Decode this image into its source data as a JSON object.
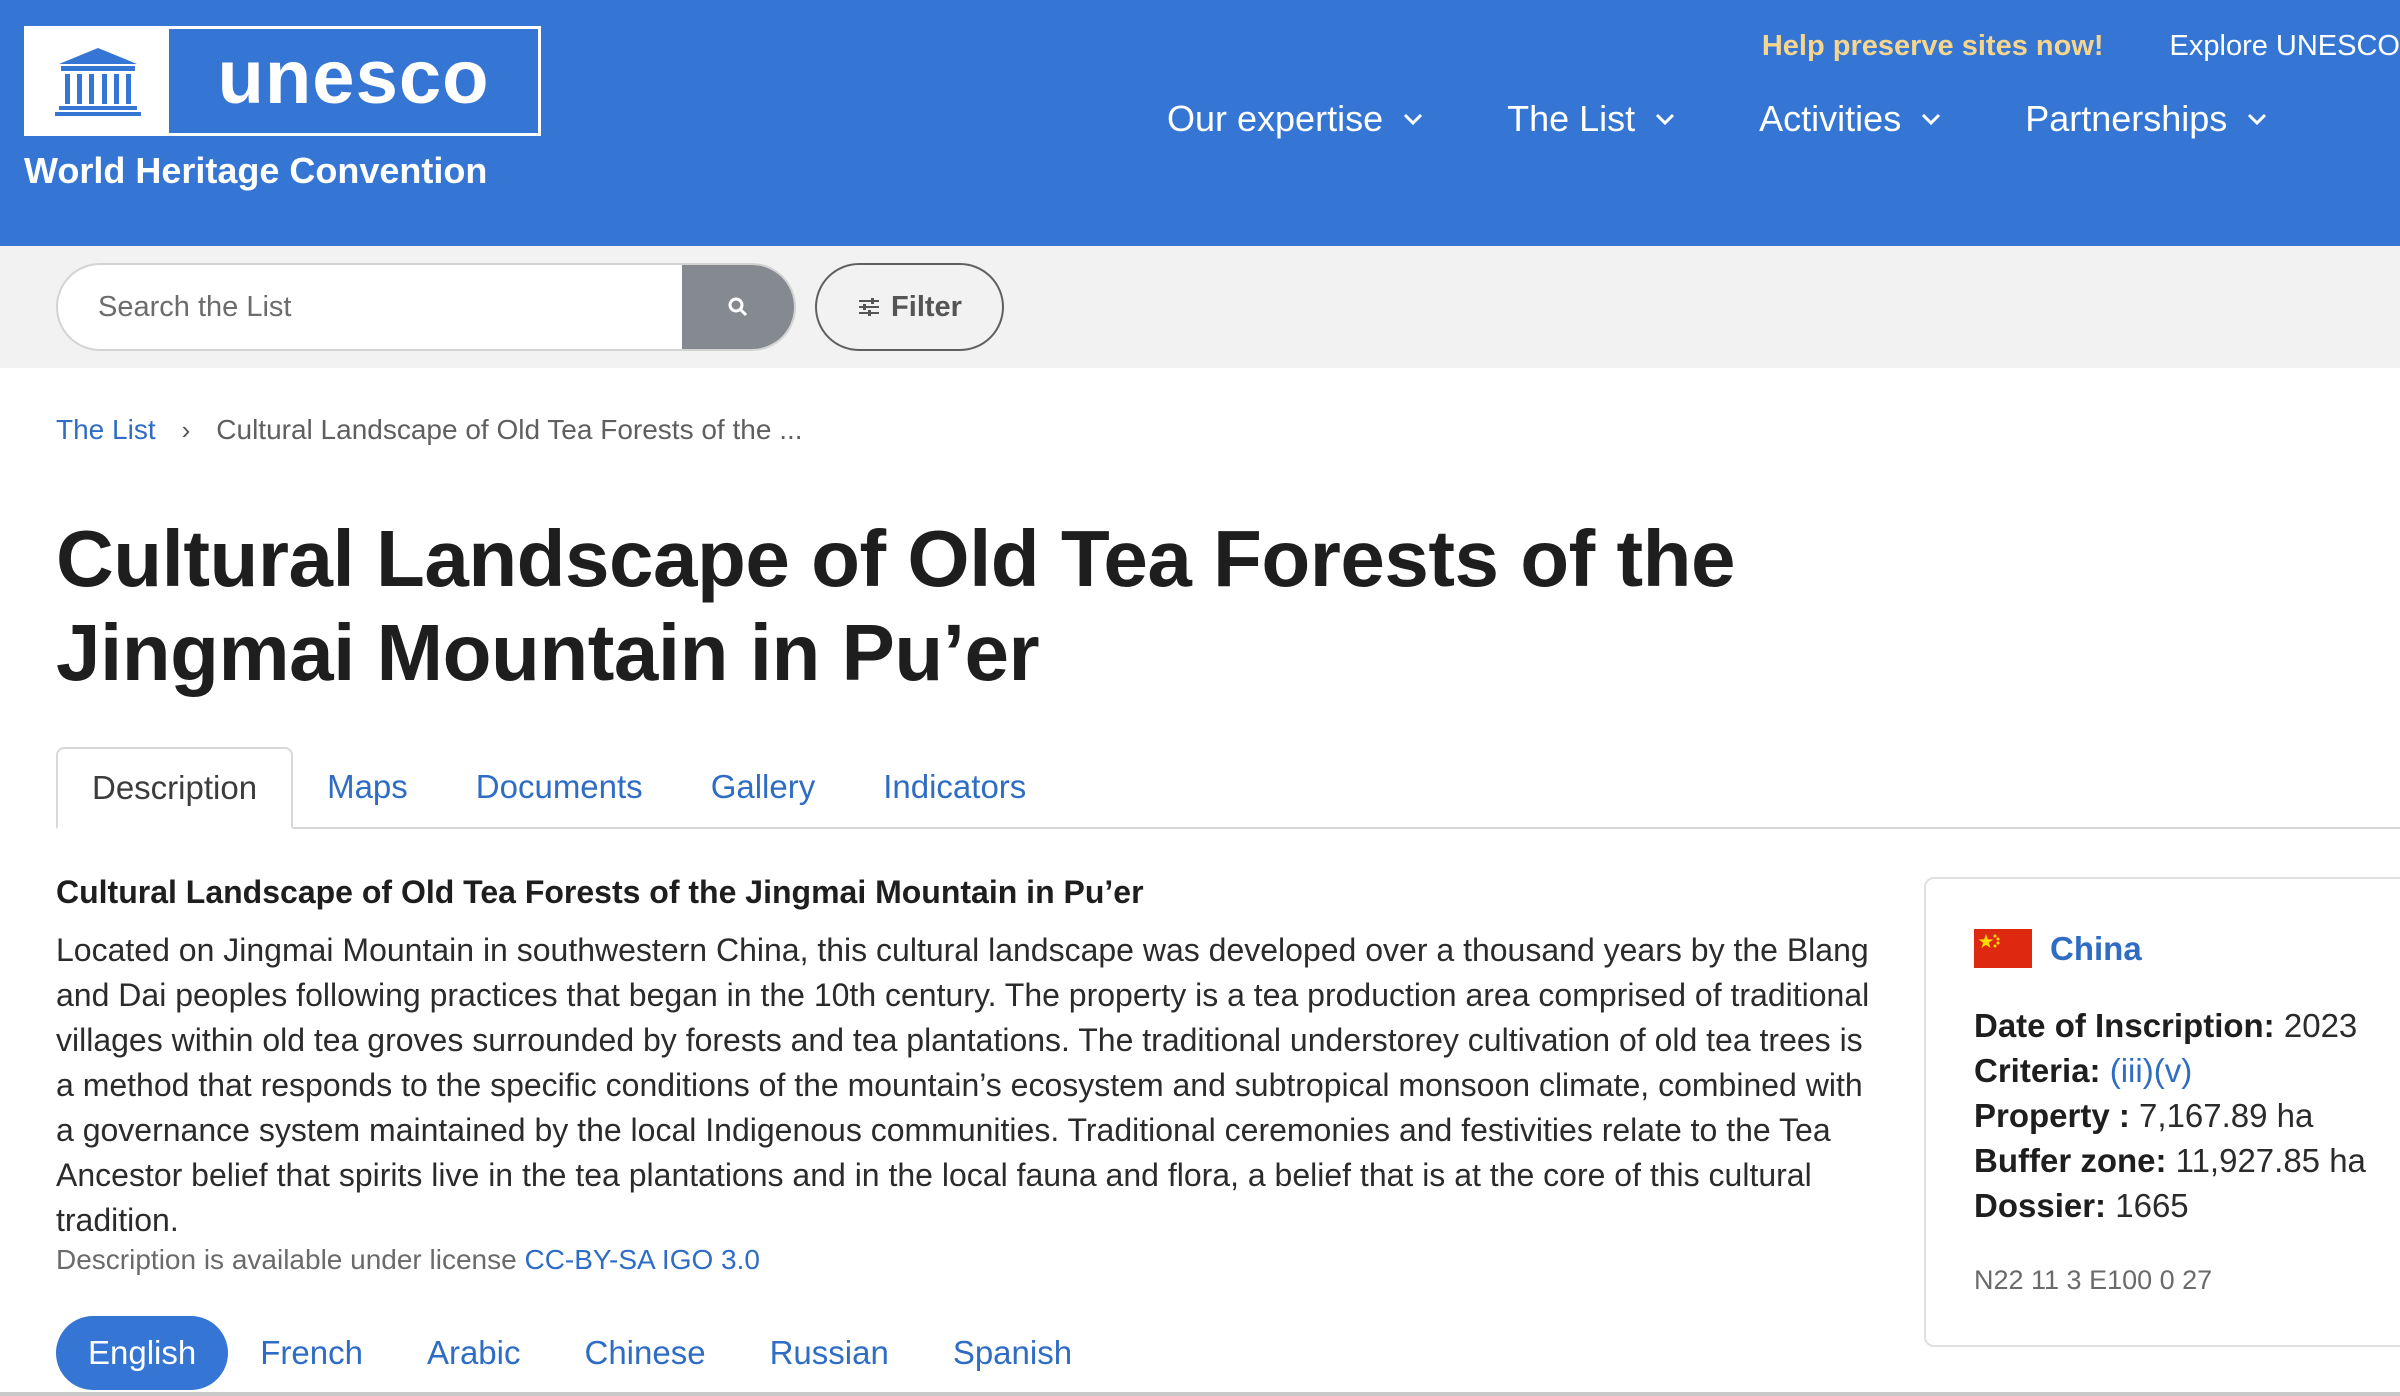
{
  "header": {
    "logo_text": "unesco",
    "logo_emblem_text": "UNESCO",
    "subtitle": "World Heritage Convention",
    "help_link": "Help preserve sites now!",
    "explore_link": "Explore UNESCO",
    "nav": [
      {
        "label": "Our expertise"
      },
      {
        "label": "The List"
      },
      {
        "label": "Activities"
      },
      {
        "label": "Partnerships"
      }
    ]
  },
  "search": {
    "placeholder": "Search the List",
    "filter_label": "Filter"
  },
  "breadcrumb": {
    "root": "The List",
    "current": "Cultural Landscape of Old Tea Forests of the ..."
  },
  "page": {
    "title": "Cultural Landscape of Old Tea Forests of the Jingmai Mountain in Pu’er",
    "tabs": [
      {
        "label": "Description",
        "active": true
      },
      {
        "label": "Maps"
      },
      {
        "label": "Documents"
      },
      {
        "label": "Gallery"
      },
      {
        "label": "Indicators"
      }
    ]
  },
  "description": {
    "heading": "Cultural Landscape of Old Tea Forests of the Jingmai Mountain in Pu’er",
    "body": "Located on Jingmai Mountain in southwestern China, this cultural landscape was developed over a thousand years by the Blang and Dai peoples following practices that began in the 10th century. The property is a tea production area comprised of traditional villages within old tea groves surrounded by forests and tea plantations. The traditional understorey cultivation of old tea trees is a method that responds to the specific conditions of the mountain’s ecosystem and subtropical monsoon climate, combined with a governance system maintained by the local Indigenous communities. Traditional ceremonies and festivities relate to the Tea Ancestor belief that spirits live in the tea plantations and in the local fauna and flora, a belief that is at the core of this cultural tradition.",
    "license_prefix": "Description is available under license",
    "license_link": "CC-BY-SA IGO 3.0"
  },
  "languages": [
    {
      "label": "English",
      "active": true
    },
    {
      "label": "French"
    },
    {
      "label": "Arabic"
    },
    {
      "label": "Chinese"
    },
    {
      "label": "Russian"
    },
    {
      "label": "Spanish"
    }
  ],
  "info_card": {
    "country": "China",
    "date_label": "Date of Inscription:",
    "date_value": "2023",
    "criteria_label": "Criteria:",
    "criteria": [
      "(iii)",
      "(v)"
    ],
    "property_label": "Property :",
    "property_value": "7,167.89 ha",
    "buffer_label": "Buffer zone:",
    "buffer_value": "11,927.85 ha",
    "dossier_label": "Dossier:",
    "dossier_value": "1665",
    "coordinates": "N22 11 3 E100 0 27"
  },
  "colors": {
    "brand_blue": "#3575d3",
    "link_blue": "#2f6dc4",
    "help_yellow": "#f6d58f",
    "flag_red": "#de2910"
  }
}
